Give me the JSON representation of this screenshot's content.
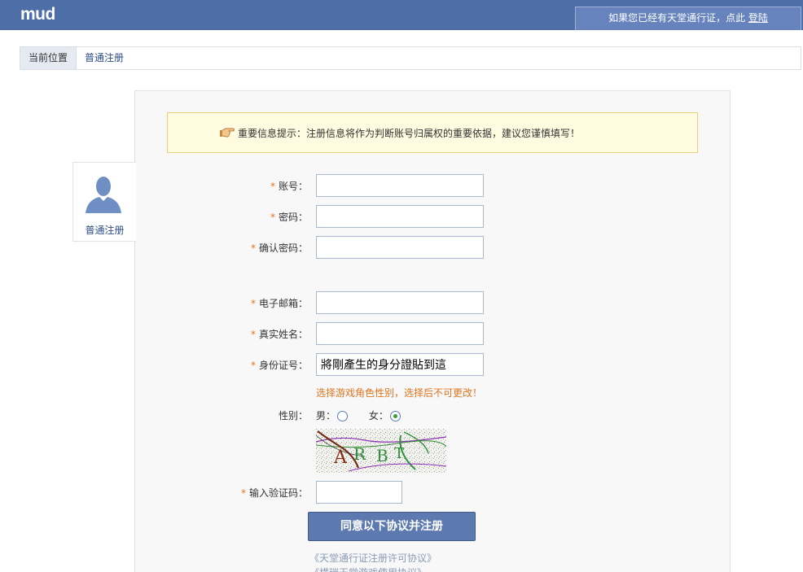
{
  "header": {
    "logo": "mud",
    "login_prompt": "如果您已经有天堂通行证，点此",
    "login_link": "登陆"
  },
  "breadcrumb": {
    "label": "当前位置",
    "current": "普通注册"
  },
  "sidebar": {
    "label": "普通注册",
    "icon": "user-avatar-icon"
  },
  "notice": {
    "icon": "hand-pointer-icon",
    "text": "重要信息提示：注册信息将作为判断账号归属权的重要依据，建议您谨慎填写！"
  },
  "form": {
    "required_mark": "*",
    "account_label": "账号：",
    "account_value": "",
    "password_label": "密码：",
    "password_value": "",
    "confirm_password_label": "确认密码：",
    "confirm_password_value": "",
    "email_label": "电子邮箱：",
    "email_value": "",
    "realname_label": "真实姓名：",
    "realname_value": "",
    "idcard_label": "身份证号：",
    "idcard_value": "將剛產生的身分證貼到這",
    "gender_hint": "选择游戏角色性别，选择后不可更改！",
    "gender_label": "性别：",
    "gender_male": "男：",
    "gender_female": "女：",
    "gender_selected": "女",
    "captcha_text": "ARBT",
    "captcha_label": "输入验证码：",
    "captcha_value": "",
    "submit_label": "同意以下协议并注册",
    "agreement_1": "《天堂通行证注册许可协议》",
    "agreement_2": "《横瑞天堂游戏使用协议》"
  },
  "colors": {
    "header_bg": "#4e6ea8",
    "required": "#e2741f",
    "link": "#2b4c86",
    "notice_bg": "#fffbe0",
    "notice_border": "#e9cf7a",
    "button_bg": "#5c79b0"
  }
}
